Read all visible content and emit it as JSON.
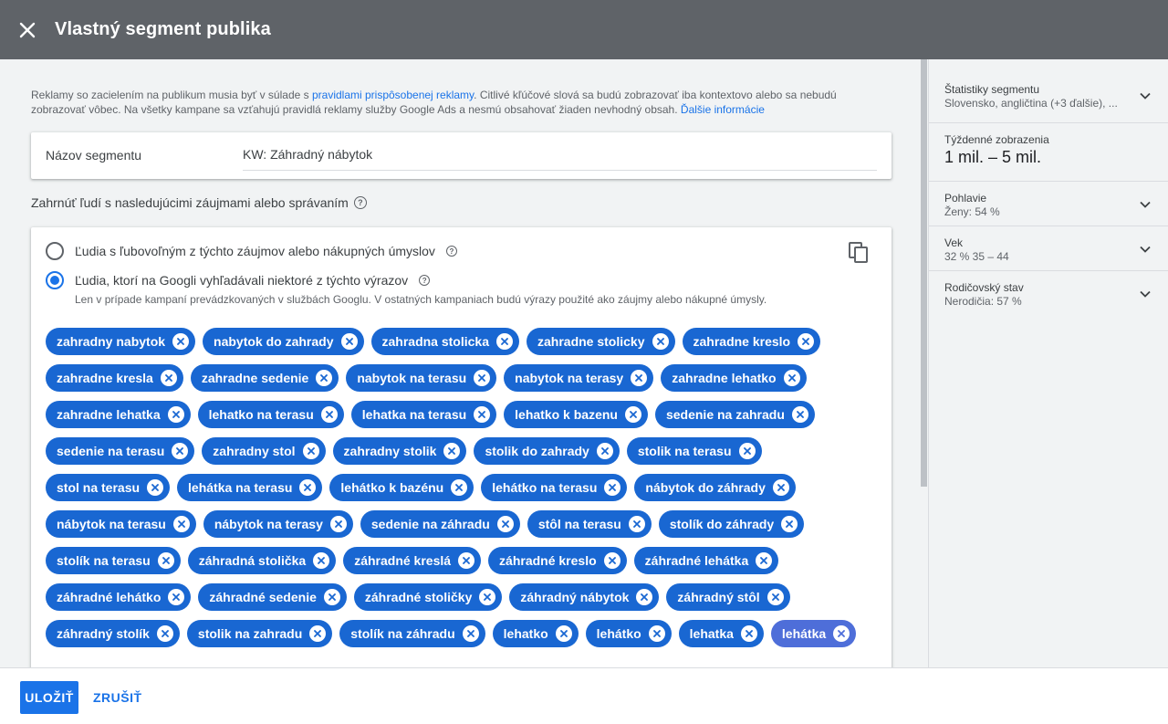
{
  "header": {
    "title": "Vlastný segment publika"
  },
  "policy": {
    "text_before": "Reklamy so zacielením na publikum musia byť v súlade s ",
    "link1": "pravidlami prispôsobenej reklamy",
    "text_middle": ". Citlivé kľúčové slová sa budú zobrazovať iba kontextovo alebo sa nebudú zobrazovať vôbec. Na všetky kampane sa vzťahujú pravidlá reklamy služby Google Ads a nesmú obsahovať žiaden nevhodný obsah. ",
    "link2": "Ďalšie informácie"
  },
  "segment_name": {
    "label": "Názov segmentu",
    "value": "KW: Záhradný nábytok"
  },
  "include": {
    "label": "Zahrnúť ľudí s nasledujúcimi záujmami alebo správaním"
  },
  "options": {
    "radio1": "Ľudia s ľubovoľným z týchto záujmov alebo nákupných úmyslov",
    "radio2": "Ľudia, ktorí na Googli vyhľadávali niektoré z týchto výrazov",
    "radio2_sub": "Len v prípade kampaní prevádzkovaných v službách Googlu. V ostatných kampaniach budú výrazy použité ako záujmy alebo nákupné úmysly.",
    "selected": 2
  },
  "chip_rows": [
    [
      "zahradny nabytok",
      "nabytok do zahrady",
      "zahradna stolicka",
      "zahradne stolicky",
      "zahradne kreslo"
    ],
    [
      "zahradne kresla",
      "zahradne sedenie",
      "nabytok na terasu",
      "nabytok na terasy",
      "zahradne lehatko"
    ],
    [
      "zahradne lehatka",
      "lehatko na terasu",
      "lehatka na terasu",
      "lehatko k bazenu",
      "sedenie na zahradu"
    ],
    [
      "sedenie na terasu",
      "zahradny stol",
      "zahradny stolik",
      "stolik do zahrady",
      "stolik na terasu"
    ],
    [
      "stol na terasu",
      "lehátka na terasu",
      "lehátko k bazénu",
      "lehátko na terasu",
      "nábytok do záhrady"
    ],
    [
      "nábytok na terasu",
      "nábytok na terasy",
      "sedenie na záhradu",
      "stôl na terasu",
      "stolík do záhrady"
    ],
    [
      "stolík na terasu",
      "záhradná stolička",
      "záhradné kreslá",
      "záhradné kreslo",
      "záhradné lehátka"
    ],
    [
      "záhradné lehátko",
      "záhradné sedenie",
      "záhradné stoličky",
      "záhradný nábytok",
      "záhradný stôl"
    ],
    [
      "záhradný stolík",
      "stolik na zahradu",
      "stolík na záhradu",
      "lehatko",
      "lehátko",
      "lehatka",
      "lehátka"
    ]
  ],
  "active_chip": "lehátka",
  "side": {
    "stats": {
      "title": "Štatistiky segmentu",
      "sub": "Slovensko, angličtina (+3 ďalšie), ..."
    },
    "weekly": {
      "title": "Týždenné zobrazenia",
      "value": "1 mil. – 5 mil."
    },
    "gender": {
      "title": "Pohlavie",
      "sub": "Ženy: 54 %"
    },
    "age": {
      "title": "Vek",
      "sub": "32 % 35 – 44"
    },
    "parent": {
      "title": "Rodičovský stav",
      "sub": "Nerodičia: 57 %"
    }
  },
  "footer": {
    "save": "ULOŽIŤ",
    "cancel": "ZRUŠIŤ"
  },
  "icons": {
    "close": "close-icon",
    "help": "help-icon",
    "copy": "copy-icon",
    "chip_remove": "close-circle-icon",
    "chevron": "chevron-down-icon"
  },
  "colors": {
    "primary": "#1a73e8",
    "chip": "#1967d2",
    "chip_active": "#4e6ed9",
    "header": "#5f6368"
  }
}
